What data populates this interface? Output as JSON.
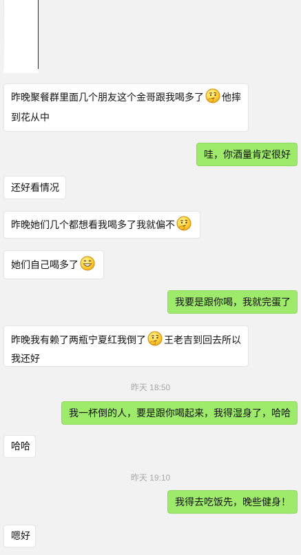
{
  "messages": [
    {
      "side": "in",
      "type": "image"
    },
    {
      "side": "in",
      "parts": [
        "昨晚聚餐群里面几个朋友这个金哥跟我喝多了",
        "他摔到花从中"
      ]
    },
    {
      "side": "out",
      "text": "哇，你酒量肯定很好"
    },
    {
      "side": "in",
      "text": "还好看情况"
    },
    {
      "side": "in",
      "text": "昨晚她们几个都想看我喝多了我就偏不"
    },
    {
      "side": "in",
      "text": "她们自己喝多了"
    },
    {
      "side": "out",
      "text": "我要是跟你喝，我就完蛋了"
    },
    {
      "side": "in",
      "parts": [
        "昨晚我有赖了两瓶宁夏红我倒了",
        "王老吉到回去所以我还好"
      ]
    },
    {
      "side": "out",
      "text": "我一杯倒的人，要是跟你喝起来，我得湿身了，哈哈"
    },
    {
      "side": "in",
      "text": "哈哈"
    },
    {
      "side": "out",
      "text": "我得去吃饭先，晚些健身！"
    },
    {
      "side": "in",
      "text": "嗯好"
    }
  ],
  "timestamps": [
    "昨天 18:50",
    "昨天 19:10"
  ],
  "emoji": {
    "thinking": "thinking-face-emoji",
    "grin": "grinning-face-emoji"
  },
  "colors": {
    "background": "#f2f2f2",
    "incoming_bubble": "#ffffff",
    "outgoing_bubble": "#9eea6a",
    "timestamp_text": "#a8a8a8"
  }
}
